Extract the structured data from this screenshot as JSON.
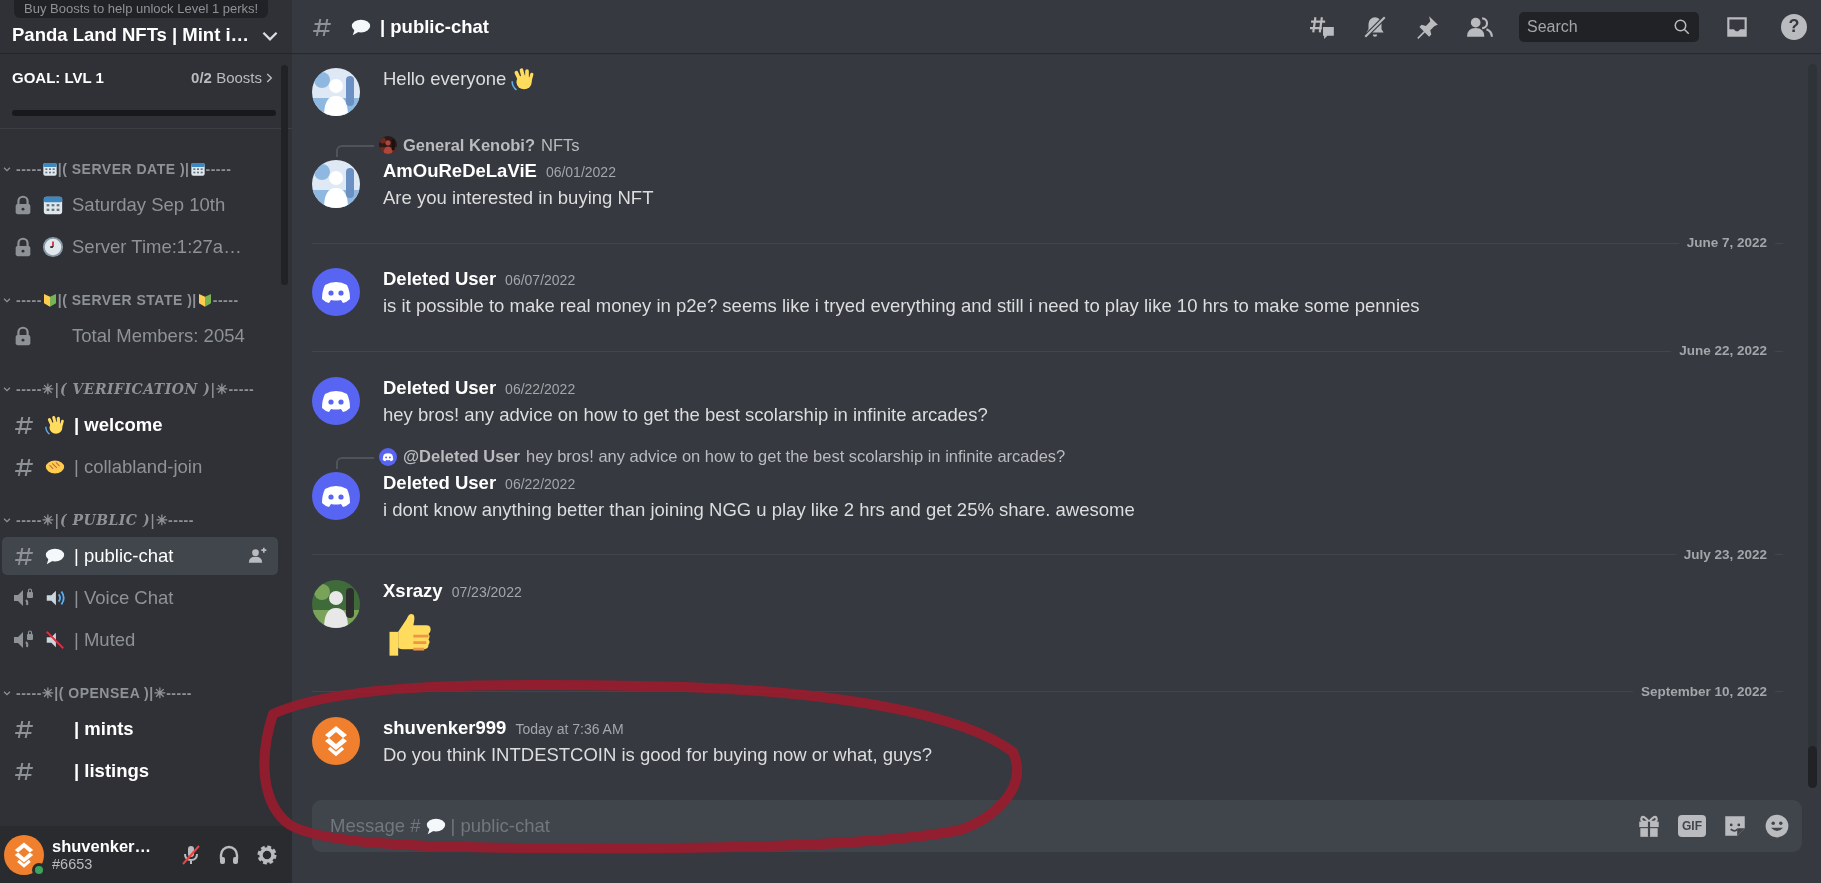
{
  "server": {
    "name": "Panda Land NFTs | Mint i…",
    "tooltip": "Buy Boosts to help unlock Level 1 perks!"
  },
  "boost": {
    "goal": "GOAL: LVL 1",
    "count": "**0/2** Boosts",
    "level": 0
  },
  "categories": [
    {
      "kind": "plain",
      "left": "-----",
      "label": "|( SERVER DATE )|",
      "right": "-----",
      "channels": [
        {
          "kind": "locked",
          "name": "Saturday Sep 10th",
          "unread": false,
          "selected": false
        },
        {
          "kind": "locked",
          "name": "Server Time:1:27a…",
          "unread": false,
          "selected": false
        }
      ]
    },
    {
      "kind": "plain",
      "left": "-----",
      "label": "|( SERVER STATE )|",
      "right": "-----",
      "channels": [
        {
          "kind": "locked",
          "name": "Total Members: 2054",
          "unread": false,
          "selected": false
        }
      ]
    },
    {
      "kind": "fancy",
      "left": "-----✳",
      "label": "|( VERIFICATION )|",
      "right": "✳-----",
      "channels": [
        {
          "kind": "text",
          "name": "| welcome",
          "unread": true,
          "selected": false
        },
        {
          "kind": "text",
          "name": "| collabland-join",
          "unread": false,
          "selected": false
        }
      ]
    },
    {
      "kind": "fancy",
      "left": "-----✳",
      "label": "|( PUBLIC )|",
      "right": "✳-----",
      "channels": [
        {
          "kind": "text",
          "name": "| public-chat",
          "unread": false,
          "selected": true
        },
        {
          "kind": "voice",
          "name": "| Voice Chat",
          "unread": false,
          "selected": false
        },
        {
          "kind": "voice",
          "name": "| Muted",
          "unread": false,
          "selected": false
        }
      ]
    },
    {
      "kind": "plain",
      "left": "-----✳",
      "label": "|( OPENSEA )|",
      "right": "✳-----",
      "channels": [
        {
          "kind": "text",
          "name": "| mints",
          "unread": true,
          "selected": false
        },
        {
          "kind": "text",
          "name": "| listings",
          "unread": true,
          "selected": false
        }
      ]
    }
  ],
  "user": {
    "name": "shuvenker…",
    "tag": "#6653",
    "online": true,
    "mic_muted": true
  },
  "header": {
    "channel": "| public-chat",
    "search": {
      "placeholder": "Search"
    },
    "help_label": "?"
  },
  "messages": [
    {
      "kind": "message",
      "text": "Hello everyone"
    },
    {
      "kind": "message",
      "reply": {
        "author": "General Kenobi?",
        "text": "NFTs"
      },
      "author": "AmOuReDeLaViE",
      "time": "06/01/2022",
      "text": "Are you interested in buying NFT"
    },
    {
      "kind": "divider",
      "text": "June 7, 2022"
    },
    {
      "kind": "message",
      "author": "Deleted User",
      "time": "06/07/2022",
      "text": "is it possible to make real money in p2e? seems like i tryed everything and still i need to play like 10 hrs to make some pennies"
    },
    {
      "kind": "divider",
      "text": "June 22, 2022"
    },
    {
      "kind": "message",
      "author": "Deleted User",
      "time": "06/22/2022",
      "text": "hey bros! any advice on how to get the best scolarship in infinite arcades?"
    },
    {
      "kind": "message",
      "reply": {
        "author": "@Deleted User",
        "text": "hey bros! any advice on how to get the best scolarship in infinite arcades?"
      },
      "author": "Deleted User",
      "time": "06/22/2022",
      "text": "i dont know anything better than joining NGG u play like 2 hrs and get 25% share. awesome"
    },
    {
      "kind": "divider",
      "text": "July 23, 2022"
    },
    {
      "kind": "message",
      "author": "Xsrazy",
      "time": "07/23/2022"
    },
    {
      "kind": "divider",
      "text": "September 10, 2022"
    },
    {
      "kind": "message",
      "author": "shuvenker999",
      "time": "Today at 7:36 AM",
      "text": "Do you think INTDESTCOIN is good for buying now or what, guys?"
    }
  ],
  "composer": {
    "hint_start": "Message #",
    "hint_end": "| public-chat",
    "gif_label": "GIF"
  }
}
